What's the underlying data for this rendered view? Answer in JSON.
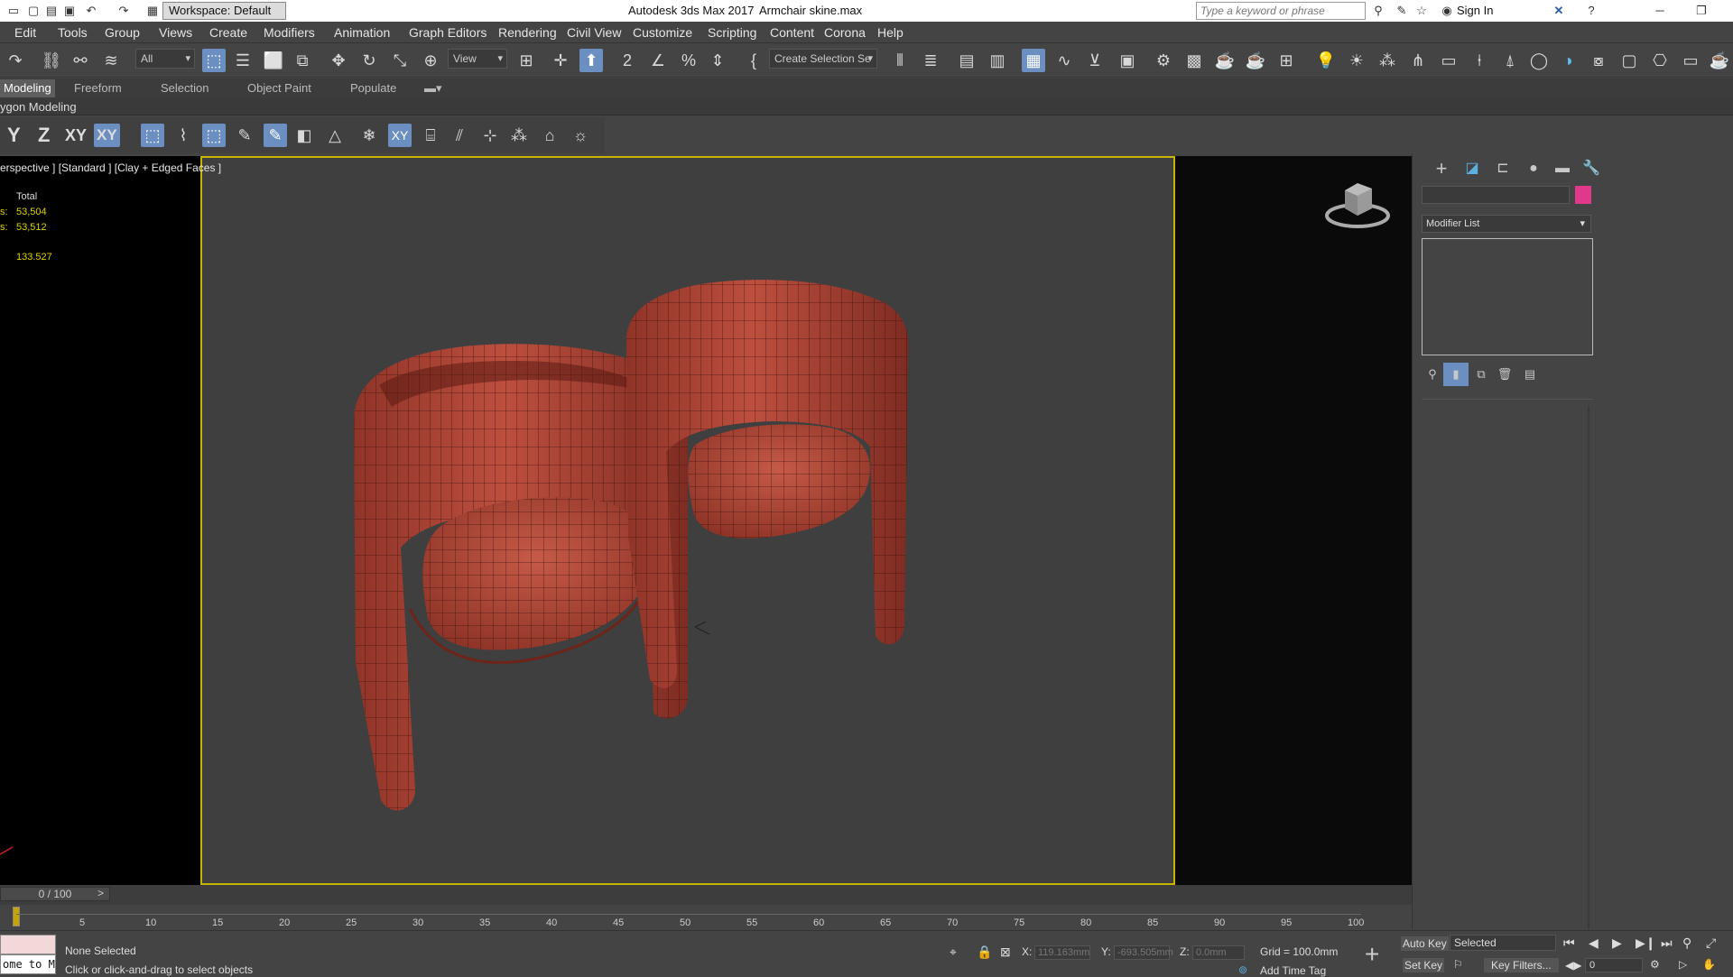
{
  "titlebar": {
    "workspace": "Workspace: Default",
    "app_title": "Autodesk 3ds Max 2017",
    "file_name": "Armchair skine.max",
    "search_placeholder": "Type a keyword or phrase",
    "sign_in": "Sign In"
  },
  "menu": [
    "Edit",
    "Tools",
    "Group",
    "Views",
    "Create",
    "Modifiers",
    "Animation",
    "Graph Editors",
    "Rendering",
    "Civil View",
    "Customize",
    "Scripting",
    "Content",
    "Corona",
    "Help"
  ],
  "toolbar": {
    "filter": "All",
    "ref_coord": "View",
    "selection_set": "Create Selection Se"
  },
  "ribbon": {
    "tabs": [
      "Modeling",
      "Freeform",
      "Selection",
      "Object Paint",
      "Populate"
    ],
    "sub_label": "ygon Modeling"
  },
  "axes": [
    "Y",
    "Z",
    "XY",
    "XY"
  ],
  "viewport": {
    "label": "erspective ] [Standard ] [Clay + Edged Faces ]",
    "stats_header": "Total",
    "stats_polys_prefix": "s:",
    "stats_polys": "53,504",
    "stats_verts_prefix": "s:",
    "stats_verts": "53,512",
    "fps": "133.527"
  },
  "command_panel": {
    "modifier_list": "Modifier List",
    "color_swatch": "#e0388a"
  },
  "timeline": {
    "frame": "0 / 100",
    "ticks": [
      "5",
      "10",
      "15",
      "20",
      "25",
      "30",
      "35",
      "40",
      "45",
      "50",
      "55",
      "60",
      "65",
      "70",
      "75",
      "80",
      "85",
      "90",
      "95",
      "100"
    ]
  },
  "status": {
    "maxscript": "ome to M",
    "selection": "None Selected",
    "prompt": "Click or click-and-drag to select objects",
    "x_label": "X:",
    "x_value": "119.163mm",
    "y_label": "Y:",
    "y_value": "-693.505mm",
    "z_label": "Z:",
    "z_value": "0.0mm",
    "grid": "Grid = 100.0mm",
    "add_time_tag": "Add Time Tag",
    "auto_key": "Auto Key",
    "set_key": "Set Key",
    "key_mode": "Selected",
    "key_filters": "Key Filters...",
    "current_frame": "0"
  },
  "colors": {
    "accent": "#6a8fc0",
    "viewport_border": "#c8b400",
    "chair_base": "#b24535",
    "chair_wire": "#3a0f0a"
  }
}
